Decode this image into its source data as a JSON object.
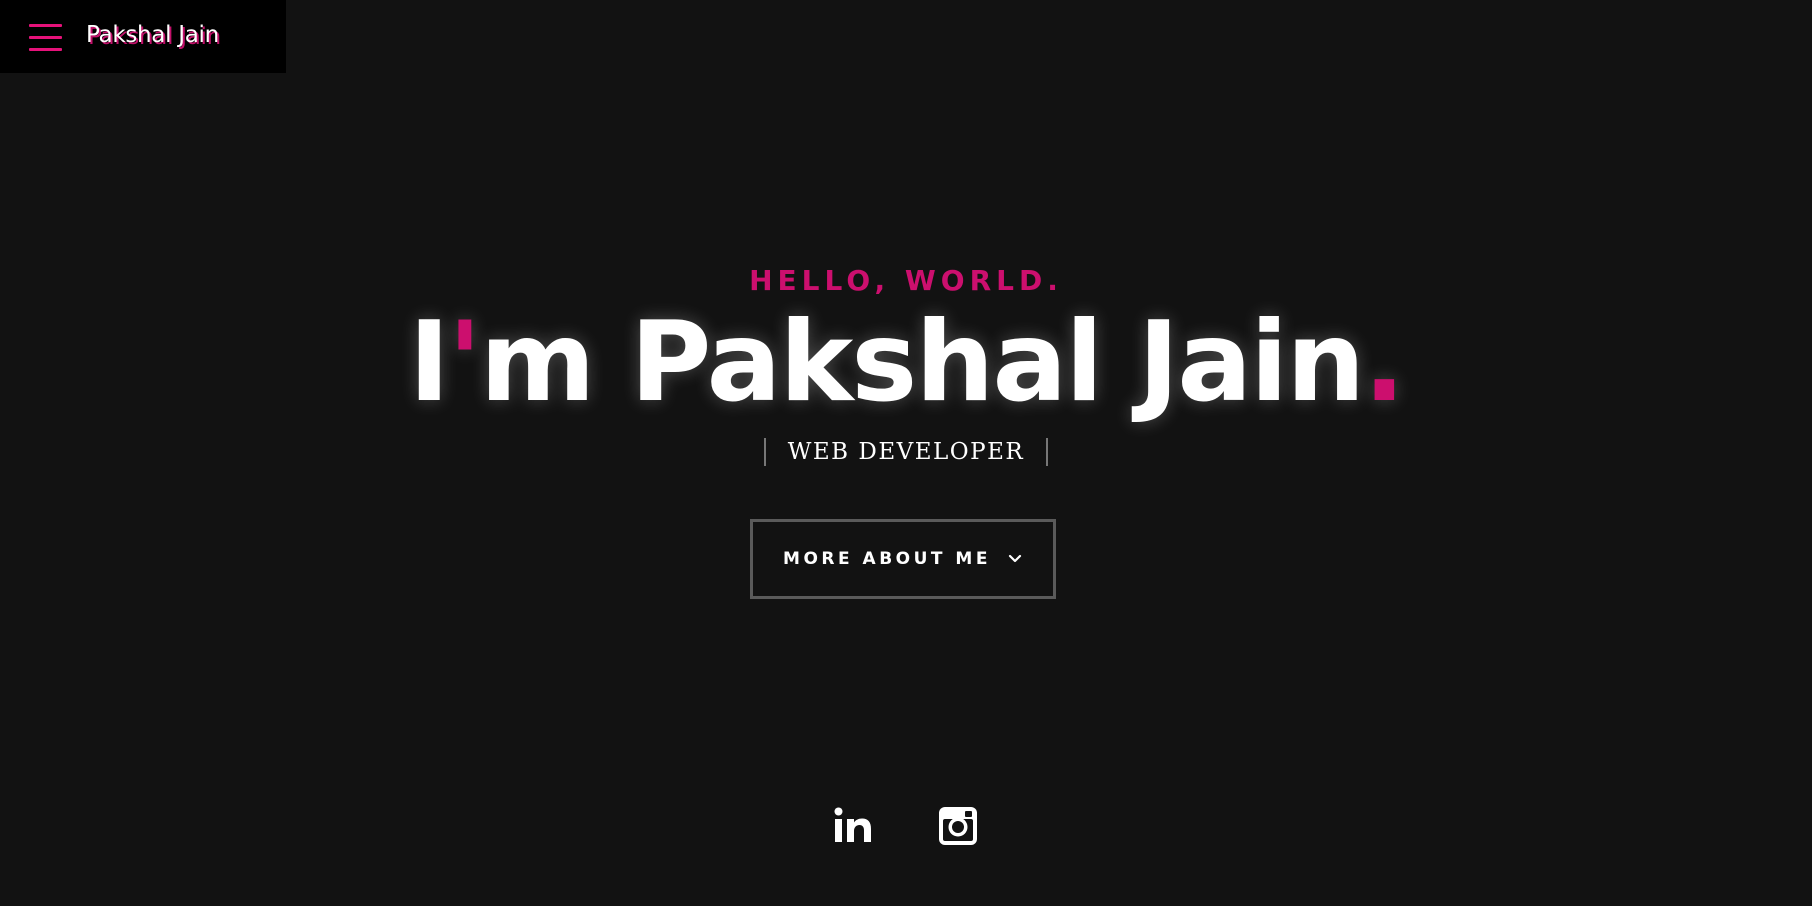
{
  "header": {
    "brand": "Pakshal Jain",
    "menu_icon": "hamburger-menu-icon"
  },
  "hero": {
    "greeting": "HELLO, WORLD.",
    "headline": {
      "part1": "I",
      "apostrophe": "'",
      "part2": "m Pakshal Jain",
      "period": "."
    },
    "subtitle": "WEB DEVELOPER",
    "cta_label": "MORE ABOUT ME",
    "cta_icon": "chevron-down-icon"
  },
  "social": [
    {
      "name": "LinkedIn",
      "icon": "linkedin-icon"
    },
    {
      "name": "Instagram",
      "icon": "instagram-icon"
    }
  ],
  "colors": {
    "background": "#121212",
    "header_bg": "#000000",
    "accent": "#cc0f6e",
    "text": "#ffffff",
    "border": "#5a5a5a"
  }
}
